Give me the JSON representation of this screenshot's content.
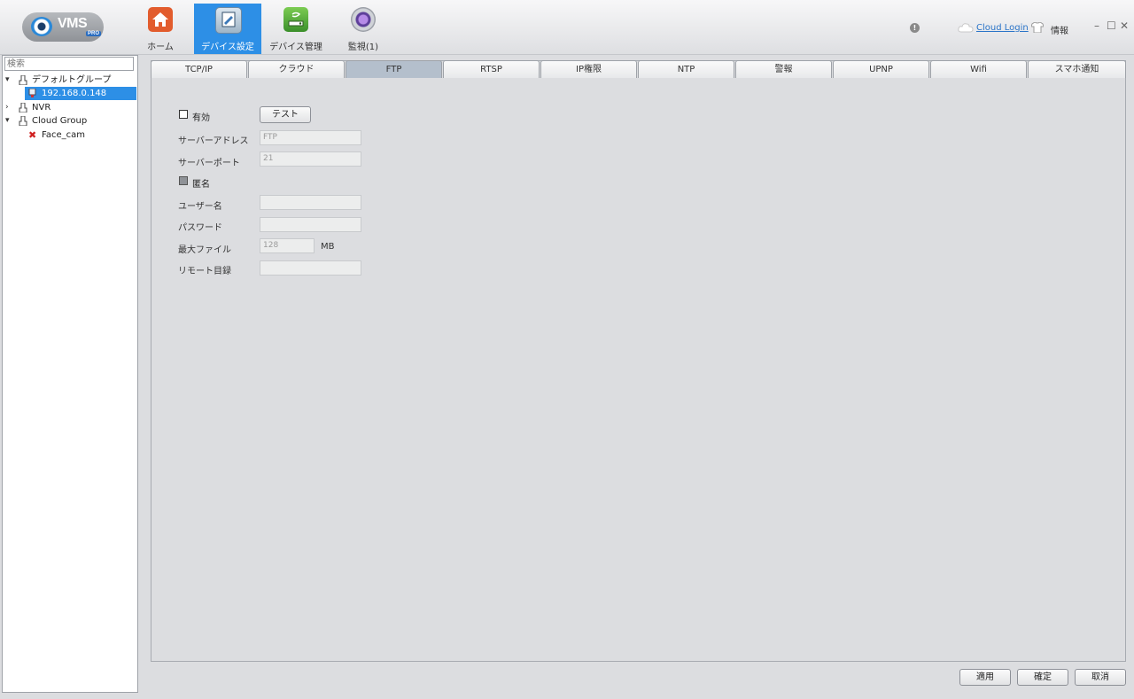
{
  "app": {
    "logo_text": "VMS",
    "logo_badge": "PRO"
  },
  "nav": [
    {
      "label": "ホーム",
      "icon": "home-icon"
    },
    {
      "label": "デバイス設定",
      "icon": "device-settings-icon",
      "active": true
    },
    {
      "label": "デバイス管理",
      "icon": "device-management-icon"
    },
    {
      "label": "監視(1)",
      "icon": "monitor-camera-icon"
    }
  ],
  "topright": {
    "alert_symbol": "!",
    "cloud_login": "Cloud Login",
    "info": "情報",
    "minimize": "–",
    "maximize": "☐",
    "close": "✕"
  },
  "sidebar": {
    "search_placeholder": "検索",
    "tree": [
      {
        "label": "デフォルトグループ",
        "type": "group",
        "expanded": true
      },
      {
        "label": "192.168.0.148",
        "type": "device",
        "selected": true
      },
      {
        "label": "NVR",
        "type": "group",
        "expanded": false
      },
      {
        "label": "Cloud Group",
        "type": "group",
        "expanded": true
      },
      {
        "label": "Face_cam",
        "type": "device-offline"
      }
    ]
  },
  "tabs": [
    "TCP/IP",
    "クラウド",
    "FTP",
    "RTSP",
    "IP権限",
    "NTP",
    "警報",
    "UPNP",
    "Wifi",
    "スマホ通知"
  ],
  "active_tab": "FTP",
  "ftp": {
    "enable_label": "有効",
    "test_button": "テスト",
    "server_address_label": "サーバーアドレス",
    "server_address_value": "FTP",
    "server_port_label": "サーバーポート",
    "server_port_value": "21",
    "anonymous_label": "匿名",
    "username_label": "ユーザー名",
    "username_value": "",
    "password_label": "パスワード",
    "password_value": "",
    "max_file_label": "最大ファイル",
    "max_file_value": "128",
    "max_file_unit": "MB",
    "remote_dir_label": "リモート目録",
    "remote_dir_value": ""
  },
  "footer": {
    "apply": "適用",
    "ok": "確定",
    "cancel": "取消"
  },
  "colors": {
    "accent": "#2d8fe6",
    "home_icon": "#e25c2d",
    "background": "#dcdde0"
  }
}
